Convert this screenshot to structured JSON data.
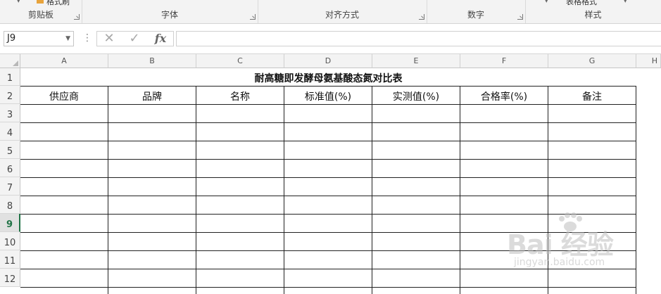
{
  "ribbon": {
    "groups": [
      {
        "label": "剪贴板",
        "top_cut_text": "格式刷"
      },
      {
        "label": "字体"
      },
      {
        "label": "对齐方式"
      },
      {
        "label": "数字"
      },
      {
        "label": "样式",
        "top_cut_text": "表格格式"
      }
    ]
  },
  "formula_bar": {
    "name_box": "J9",
    "cancel_symbol": "✕",
    "enter_symbol": "✓",
    "fx_label": "fx",
    "formula_value": ""
  },
  "columns": [
    "A",
    "B",
    "C",
    "D",
    "E",
    "F",
    "G",
    "H"
  ],
  "rows": [
    "1",
    "2",
    "3",
    "4",
    "5",
    "6",
    "7",
    "8",
    "9",
    "10",
    "11",
    "12"
  ],
  "active_row": "9",
  "sheet": {
    "title": "耐高糖即发酵母氨基酸态氮对比表",
    "headers": [
      "供应商",
      "品牌",
      "名称",
      "标准值(%)",
      "实测值(%)",
      "合格率(%)",
      "备注"
    ]
  },
  "watermark": {
    "text": "Bai 经验",
    "sub": "jingyan.baidu.com"
  },
  "colors": {
    "accent_green": "#217346",
    "header_bg": "#f3f3f3",
    "gridline": "#e1e1e1"
  }
}
